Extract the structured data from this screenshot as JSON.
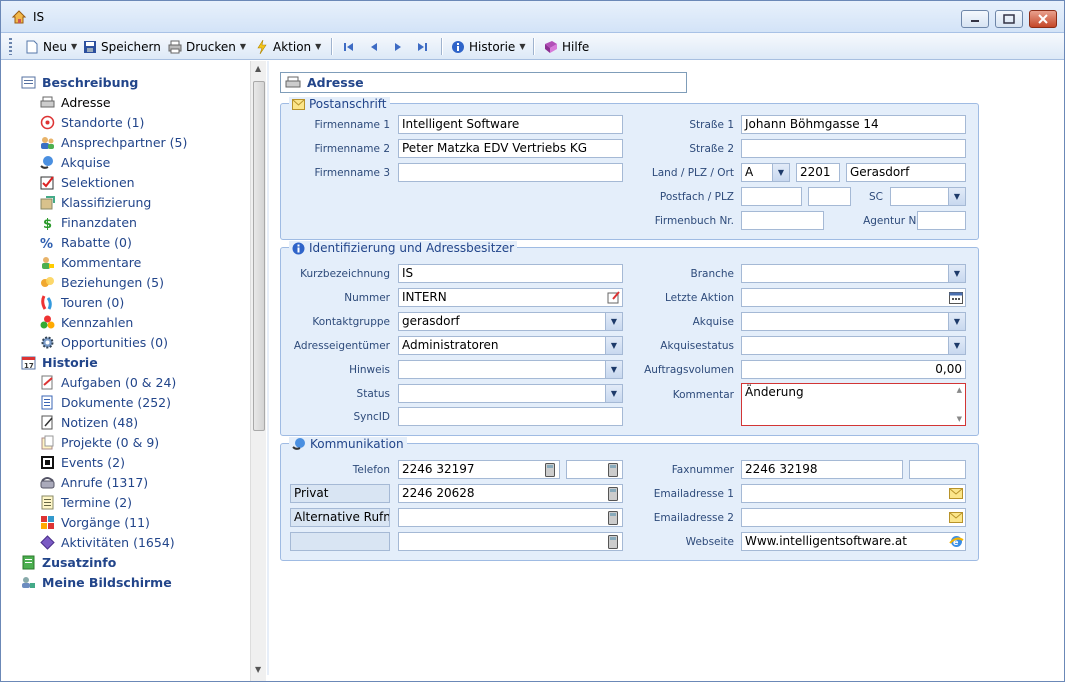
{
  "window": {
    "title": "IS"
  },
  "toolbar": {
    "neu": "Neu",
    "speichern": "Speichern",
    "drucken": "Drucken",
    "aktion": "Aktion",
    "historie": "Historie",
    "hilfe": "Hilfe"
  },
  "sidebar": {
    "beschreibung": "Beschreibung",
    "items_beschreibung": [
      {
        "label": "Adresse"
      },
      {
        "label": "Standorte (1)"
      },
      {
        "label": "Ansprechpartner (5)"
      },
      {
        "label": "Akquise"
      },
      {
        "label": "Selektionen"
      },
      {
        "label": "Klassifizierung"
      },
      {
        "label": "Finanzdaten"
      },
      {
        "label": "Rabatte (0)"
      },
      {
        "label": "Kommentare"
      },
      {
        "label": "Beziehungen (5)"
      },
      {
        "label": "Touren (0)"
      },
      {
        "label": "Kennzahlen"
      },
      {
        "label": "Opportunities (0)"
      }
    ],
    "historie": "Historie",
    "items_historie": [
      {
        "label": "Aufgaben (0 & 24)"
      },
      {
        "label": "Dokumente (252)"
      },
      {
        "label": "Notizen (48)"
      },
      {
        "label": "Projekte (0 & 9)"
      },
      {
        "label": "Events (2)"
      },
      {
        "label": "Anrufe (1317)"
      },
      {
        "label": "Termine (2)"
      },
      {
        "label": "Vorgänge (11)"
      },
      {
        "label": "Aktivitäten (1654)"
      }
    ],
    "zusatzinfo": "Zusatzinfo",
    "meine_bildschirme": "Meine Bildschirme"
  },
  "page": {
    "title": "Adresse"
  },
  "postanschrift": {
    "legend": "Postanschrift",
    "firmenname1_label": "Firmenname 1",
    "firmenname1": "Intelligent Software",
    "firmenname2_label": "Firmenname 2",
    "firmenname2": "Peter Matzka EDV Vertriebs KG",
    "firmenname3_label": "Firmenname 3",
    "firmenname3": "",
    "strasse1_label": "Straße 1",
    "strasse1": "Johann Böhmgasse 14",
    "strasse2_label": "Straße 2",
    "strasse2": "",
    "land_plz_ort_label": "Land / PLZ / Ort",
    "land": "A",
    "plz": "2201",
    "ort": "Gerasdorf",
    "postfach_label": "Postfach / PLZ",
    "sc_label": "SC",
    "firmenbuch_label": "Firmenbuch Nr.",
    "agentur_label": "Agentur Nr."
  },
  "identifizierung": {
    "legend": "Identifizierung und Adressbesitzer",
    "kurzbezeichnung_label": "Kurzbezeichnung",
    "kurzbezeichnung": "IS",
    "nummer_label": "Nummer",
    "nummer": "INTERN",
    "kontaktgruppe_label": "Kontaktgruppe",
    "kontaktgruppe": "gerasdorf",
    "adresseigentuemer_label": "Adresseigentümer",
    "adresseigentuemer": "Administratoren",
    "hinweis_label": "Hinweis",
    "status_label": "Status",
    "syncid_label": "SyncID",
    "branche_label": "Branche",
    "letzte_aktion_label": "Letzte Aktion",
    "akquise_label": "Akquise",
    "akquisestatus_label": "Akquisestatus",
    "auftragsvolumen_label": "Auftragsvolumen",
    "auftragsvolumen": "0,00",
    "kommentar_label": "Kommentar",
    "kommentar": "Änderung"
  },
  "kommunikation": {
    "legend": "Kommunikation",
    "telefon_label": "Telefon",
    "telefon": "2246 32197",
    "privat_label": "Privat",
    "privat": "2246 20628",
    "alternative_label": "Alternative Rufnu",
    "faxnummer_label": "Faxnummer",
    "faxnummer": "2246 32198",
    "email1_label": "Emailadresse 1",
    "email2_label": "Emailadresse 2",
    "webseite_label": "Webseite",
    "webseite": "Www.intelligentsoftware.at"
  }
}
